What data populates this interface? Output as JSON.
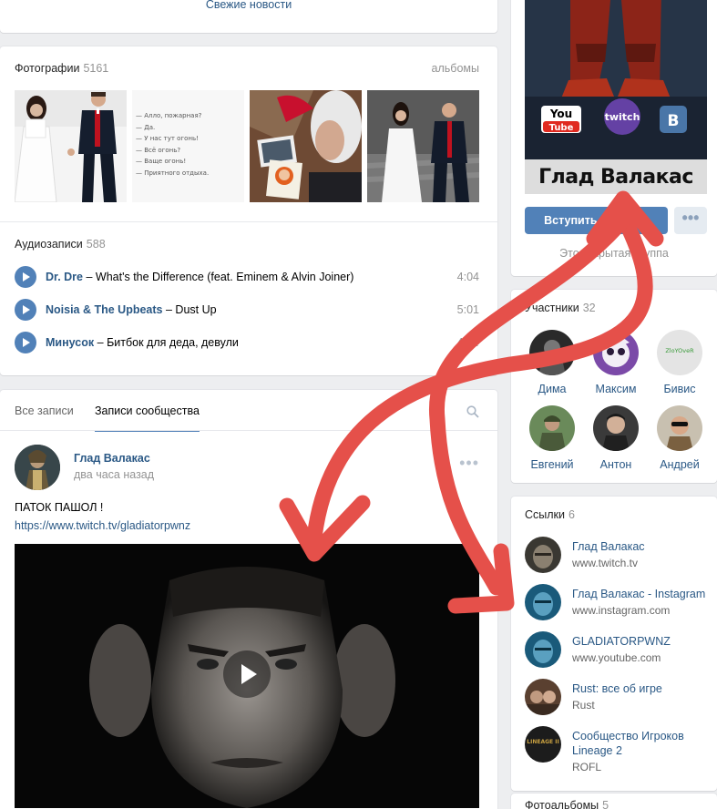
{
  "feed": {
    "fresh_news": "Свежие новости"
  },
  "photos": {
    "title": "Фотографии",
    "count": "5161",
    "albums_link": "альбомы",
    "phone_chat": [
      "— Алло, пожарная?",
      "— Да.",
      "— У нас тут огонь!",
      "— Всё огонь?",
      "— Ваще огонь!",
      "— Приятного отдыха."
    ]
  },
  "audio": {
    "title": "Аудиозаписи",
    "count": "588",
    "tracks": [
      {
        "artist": "Dr. Dre",
        "title": "What's the Difference (feat. Eminem & Alvin Joiner)",
        "duration": "4:04"
      },
      {
        "artist": "Noisia & The Upbeats",
        "title": "Dust Up",
        "duration": "5:01"
      },
      {
        "artist": "Минусок",
        "title": "Битбок для деда, девули",
        "duration": "4:04"
      }
    ],
    "dash": "–"
  },
  "wall": {
    "tabs": [
      "Все записи",
      "Записи сообщества"
    ],
    "post": {
      "author": "Глад Валакас",
      "time": "два часа назад",
      "text": "ПАТОК ПАШОЛ !",
      "link": "https://www.twitch.tv/gladiatorpwnz",
      "more": "•••"
    }
  },
  "group": {
    "cover_title": "Глад Валакас",
    "cover_logos": [
      "You",
      "Tube",
      "twitch",
      "В"
    ],
    "join_label": "Вступить в группу",
    "more_label": "•••",
    "type": "Это открытая группа"
  },
  "members": {
    "title": "Участники",
    "count": "32",
    "list": [
      {
        "name": "Дима"
      },
      {
        "name": "Максим"
      },
      {
        "name": "Бивис",
        "avatar_text": "ZloYOveR"
      },
      {
        "name": "Евгений"
      },
      {
        "name": "Антон"
      },
      {
        "name": "Андрей"
      }
    ]
  },
  "links": {
    "title": "Ссылки",
    "count": "6",
    "items": [
      {
        "title": "Глад Валакас",
        "url": "www.twitch.tv"
      },
      {
        "title": "Глад Валакас - Instagram",
        "url": "www.instagram.com"
      },
      {
        "title": "GLADIATORPWNZ",
        "url": "www.youtube.com"
      },
      {
        "title": "Rust: все об игре",
        "url": "Rust"
      },
      {
        "title": "Сообщество Игроков Lineage 2",
        "url": "ROFL",
        "avatar_text": "LINEAGE II"
      }
    ]
  },
  "photo_albums": {
    "title": "Фотоальбомы",
    "count": "5"
  },
  "colors": {
    "accent": "#5181b8",
    "link": "#2a5885",
    "arrow": "#e5504a"
  }
}
